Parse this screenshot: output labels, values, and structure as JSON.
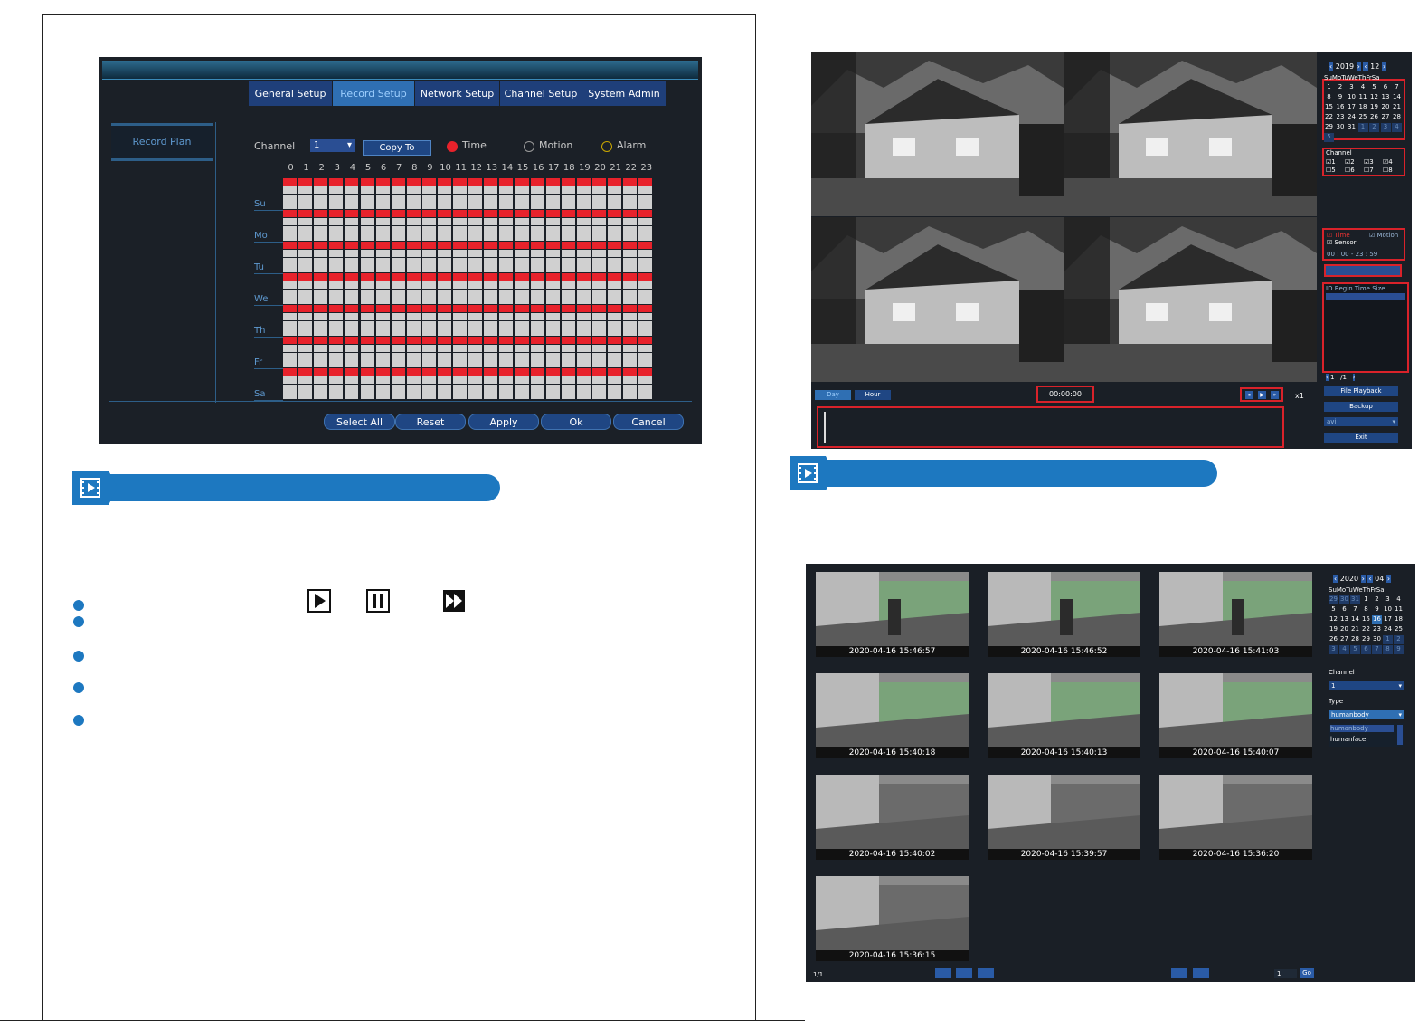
{
  "record_setup": {
    "tabs": [
      "General Setup",
      "Record Setup",
      "Network Setup",
      "Channel Setup",
      "System Admin"
    ],
    "side_item": "Record Plan",
    "channel_label": "Channel",
    "channel_value": "1",
    "copy_to": "Copy To",
    "modes": [
      "Time",
      "Motion",
      "Alarm"
    ],
    "hours": [
      "0",
      "1",
      "2",
      "3",
      "4",
      "5",
      "6",
      "7",
      "8",
      "9",
      "10",
      "11",
      "12",
      "13",
      "14",
      "15",
      "16",
      "17",
      "18",
      "19",
      "20",
      "21",
      "22",
      "23"
    ],
    "days": [
      "Su",
      "Mo",
      "Tu",
      "We",
      "Th",
      "Fr",
      "Sa"
    ],
    "buttons": [
      "Select All",
      "Reset",
      "Apply",
      "Ok",
      "Cancel"
    ],
    "colors": {
      "red": "#e8222b",
      "grey": "#d0d0d0",
      "panel": "#1b2027",
      "tab": "#1f3f7a",
      "tab_active": "#2f6fb3"
    }
  },
  "playback": {
    "calendar": {
      "year": "2019",
      "month": "12",
      "weekdays": "SuMoTuWeThFrSa"
    },
    "channel_label": "Channel",
    "channels": [
      "1",
      "2",
      "3",
      "4",
      "5",
      "6",
      "7",
      "8"
    ],
    "types": [
      "Time",
      "Motion",
      "Sensor"
    ],
    "time_range": "00 : 00  -  23 : 59",
    "list_headers": [
      "ID",
      "Begin Time",
      "Size"
    ],
    "page": "/1",
    "buttons": [
      "File Playback",
      "Backup",
      "Exit"
    ],
    "format": "avi",
    "view_buttons": [
      "Day",
      "Hour"
    ],
    "time_display": "00:00:00",
    "speed": "x1"
  },
  "snapshots": {
    "calendar": {
      "year": "2020",
      "month": "04",
      "weekdays": "SuMoTuWeThFrSa"
    },
    "channel_label": "Channel",
    "channel_value": "1",
    "type_label": "Type",
    "type_value": "humanbody",
    "type_options": [
      "humanbody",
      "humanface"
    ],
    "timestamps": [
      "2020-04-16 15:46:57",
      "2020-04-16 15:46:52",
      "2020-04-16 15:41:03",
      "2020-04-16 15:40:18",
      "2020-04-16 15:40:13",
      "2020-04-16 15:40:07",
      "2020-04-16 15:40:02",
      "2020-04-16 15:39:57",
      "2020-04-16 15:36:20",
      "2020-04-16 15:36:15"
    ],
    "page_info": "1/1",
    "page_input": "1",
    "go": "Go"
  }
}
